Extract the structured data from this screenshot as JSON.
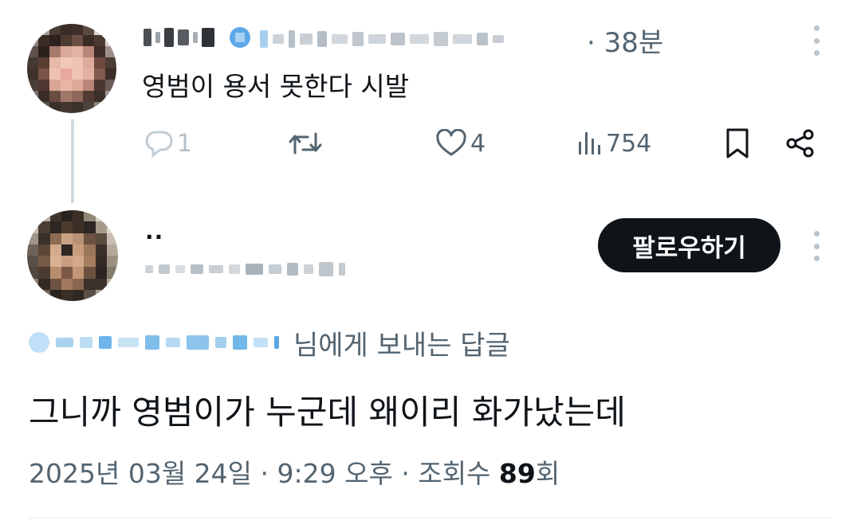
{
  "parent_tweet": {
    "time_sep": "·",
    "time_ago": "38분",
    "text": "영범이 용서 못한다 시발",
    "actions": {
      "reply_count": "1",
      "retweet_count": "",
      "like_count": "4",
      "view_count": "754"
    },
    "icons": [
      "reply-icon",
      "retweet-icon",
      "heart-icon",
      "views-icon",
      "bookmark-icon",
      "share-icon",
      "more-icon",
      "verified-badge-icon"
    ]
  },
  "reply_tweet": {
    "display_name": "..",
    "follow_label": "팔로우하기",
    "replying_to_suffix": "님에게 보내는 답글",
    "text": "그니까 영범이가 누군데 왜이리 화가났는데",
    "footer": {
      "date": "2025년 03월 24일",
      "sep1": " · ",
      "time": "9:29 오후",
      "sep2": " · ",
      "views_label": "조회수 ",
      "views_count": "89",
      "views_unit": "회"
    }
  },
  "colors": {
    "text_primary": "#0f1419",
    "text_secondary": "#536471",
    "accent_blue": "#1d9bf0",
    "follow_button_bg": "#0f1419",
    "icon_gray": "#536471"
  }
}
